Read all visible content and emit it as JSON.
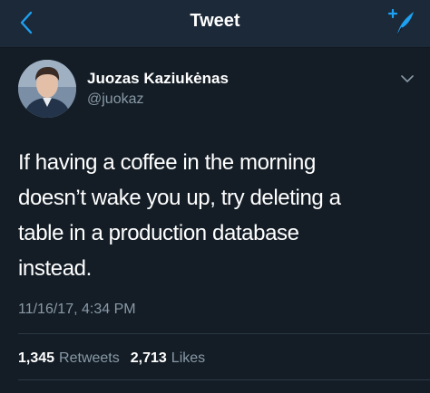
{
  "header": {
    "title": "Tweet",
    "back_icon": "chevron-left-icon",
    "compose_icon": "compose-tweet-icon",
    "accent_color": "#1da1f2"
  },
  "tweet": {
    "author": {
      "name": "Juozas Kaziukėnas",
      "handle": "@juokaz"
    },
    "text": "If having a coffee in the morning\ndoesn’t wake you up, try deleting a\ntable in a production database\ninstead.",
    "timestamp": "11/16/17, 4:34 PM",
    "retweets": {
      "count": "1,345",
      "label": "Retweets"
    },
    "likes": {
      "count": "2,713",
      "label": "Likes"
    },
    "menu_icon": "chevron-down-icon"
  },
  "colors": {
    "background": "#141d26",
    "nav_background": "#1c2938",
    "secondary_text": "#8899a6"
  }
}
